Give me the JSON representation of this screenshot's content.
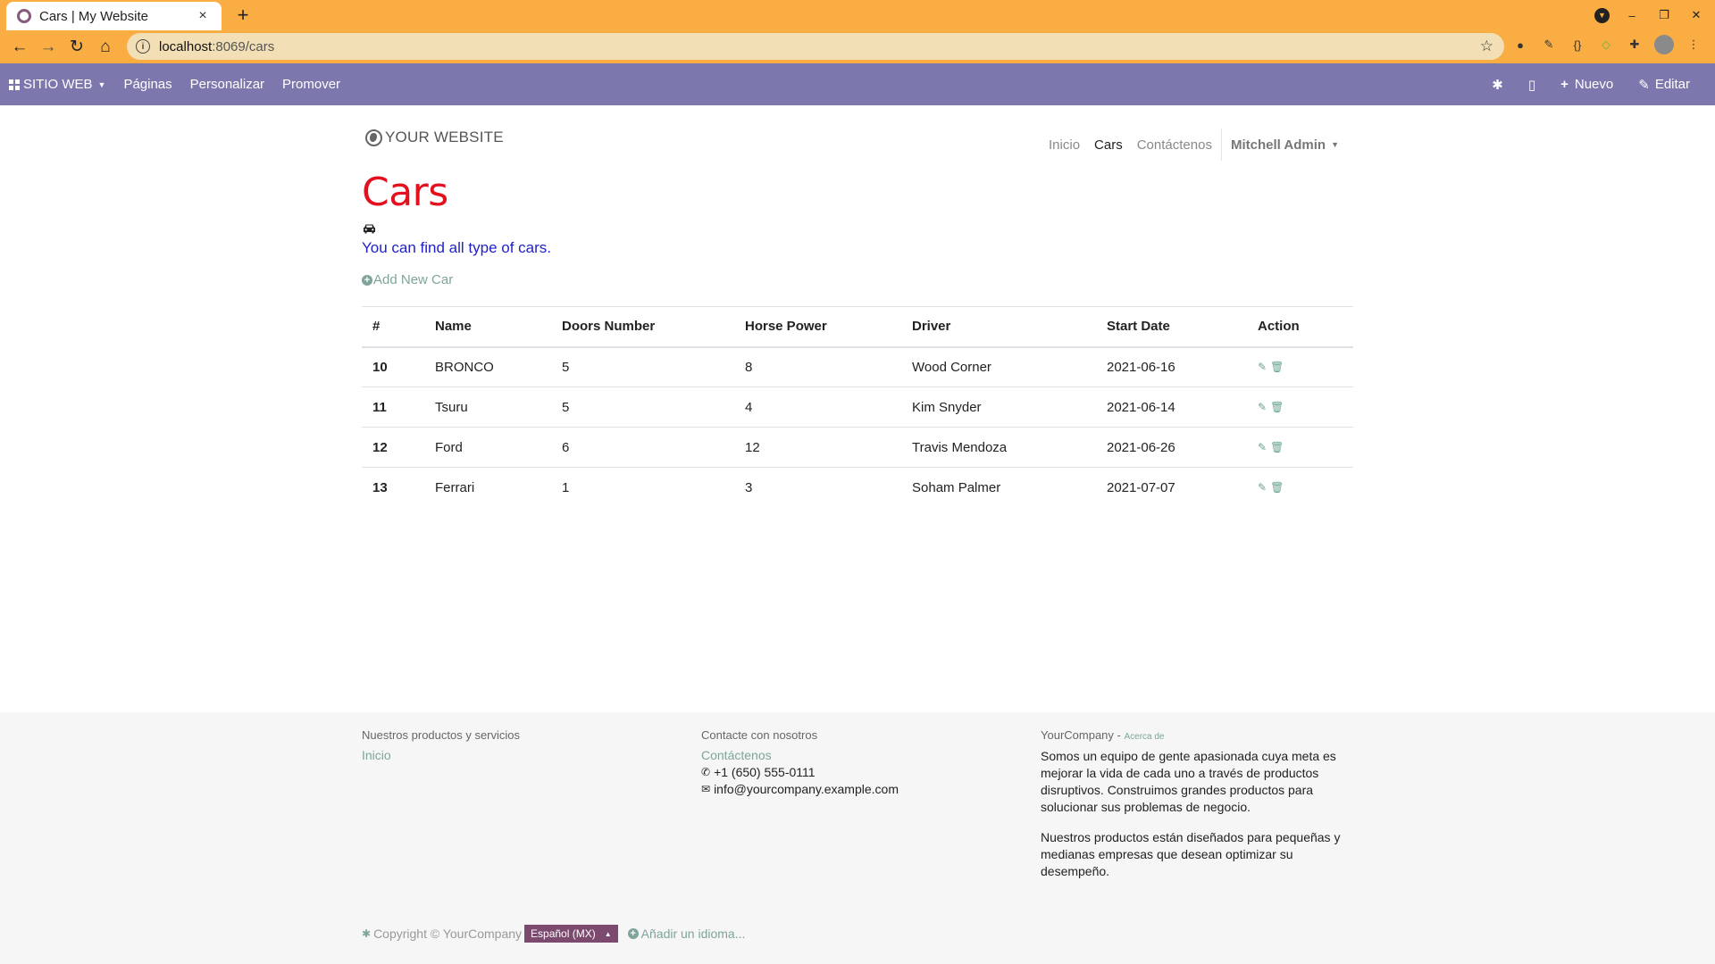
{
  "browser": {
    "tab_title": "Cars | My Website",
    "tab_close": "×",
    "new_tab": "+",
    "url_host": "localhost",
    "url_path": ":8069/cars"
  },
  "odoo_bar": {
    "apps_label": "SITIO WEB",
    "menu": [
      "Páginas",
      "Personalizar",
      "Promover"
    ],
    "new_label": "Nuevo",
    "edit_label": "Editar",
    "color": "#7c78ad"
  },
  "site": {
    "logo_text": "YOUR WEBSITE",
    "nav": [
      "Inicio",
      "Cars",
      "Contáctenos"
    ],
    "user": "Mitchell Admin"
  },
  "main": {
    "title": "Cars",
    "intro": "You can find all type of cars.",
    "add_link": "Add New Car",
    "title_color": "#e3101e",
    "intro_color": "#2120c9"
  },
  "table": {
    "headers": [
      "#",
      "Name",
      "Doors Number",
      "Horse Power",
      "Driver",
      "Start Date",
      "Action"
    ],
    "rows": [
      {
        "id": "10",
        "name": "BRONCO",
        "doors": "5",
        "hp": "8",
        "driver": "Wood Corner",
        "start": "2021-06-16"
      },
      {
        "id": "11",
        "name": "Tsuru",
        "doors": "5",
        "hp": "4",
        "driver": "Kim Snyder",
        "start": "2021-06-14"
      },
      {
        "id": "12",
        "name": "Ford",
        "doors": "6",
        "hp": "12",
        "driver": "Travis Mendoza",
        "start": "2021-06-26"
      },
      {
        "id": "13",
        "name": "Ferrari",
        "doors": "1",
        "hp": "3",
        "driver": "Soham Palmer",
        "start": "2021-07-07"
      }
    ]
  },
  "footer": {
    "col1": {
      "heading": "Nuestros productos y servicios",
      "link": "Inicio"
    },
    "col2": {
      "heading": "Contacte con nosotros",
      "link": "Contáctenos",
      "phone": "+1 (650) 555-0111",
      "email": "info@yourcompany.example.com"
    },
    "col3": {
      "heading": "YourCompany",
      "heading_sep": " - ",
      "about": "Acerca de",
      "p1": "Somos un equipo de gente apasionada cuya meta es mejorar la vida de cada uno a través de productos disruptivos. Construimos grandes productos para solucionar sus problemas de negocio.",
      "p2": "Nuestros productos están diseñados para pequeñas y medianas empresas que desean optimizar su desempeño."
    },
    "copyright": "Copyright © YourCompany",
    "language": "Español (MX)",
    "add_language": "Añadir un idioma..."
  }
}
